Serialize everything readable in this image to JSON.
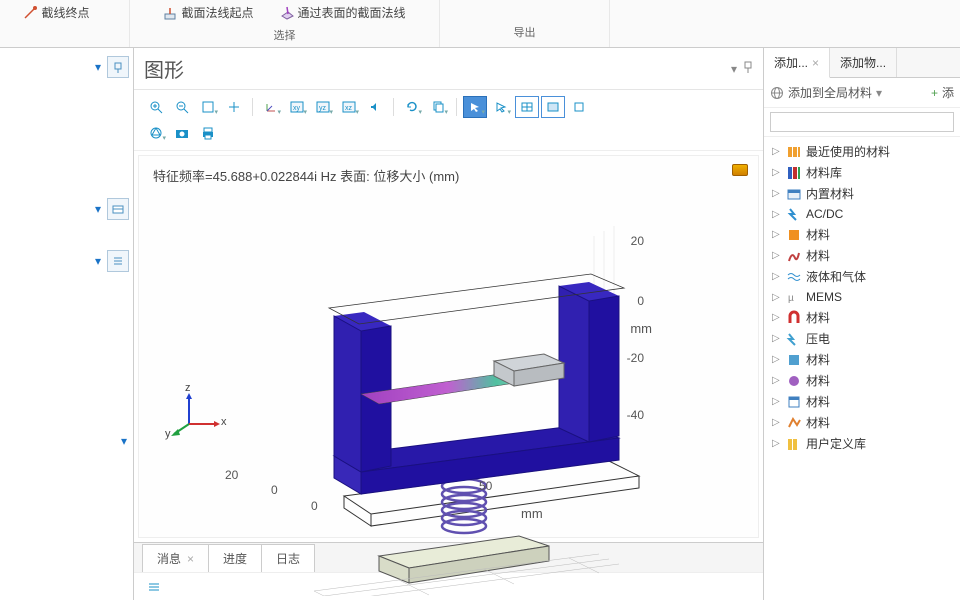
{
  "ribbon": {
    "items": [
      {
        "label": "截线终点"
      },
      {
        "label": "截面法线起点"
      },
      {
        "label": "通过表面的截面法线"
      }
    ],
    "group1": "选择",
    "group2": "导出"
  },
  "graphics": {
    "title": "图形",
    "plot_title": "特征频率=45.688+0.022844i Hz    表面: 位移大小 (mm)",
    "y_ticks": [
      "20",
      "0",
      "-20",
      "-40"
    ],
    "y_unit": "mm",
    "x_ticks_front": [
      "20",
      "0"
    ],
    "x_ticks_side": [
      "0",
      "50"
    ],
    "x_unit": "mm",
    "axes": {
      "x": "x",
      "y": "y",
      "z": "z"
    }
  },
  "bottom_tabs": {
    "items": [
      {
        "label": "消息",
        "closable": true
      },
      {
        "label": "进度",
        "closable": false
      },
      {
        "label": "日志",
        "closable": false
      }
    ]
  },
  "right": {
    "tabs": [
      {
        "label": "添加...",
        "closable": true
      },
      {
        "label": "添加物...",
        "closable": false
      }
    ],
    "sub_add": "添加到全局材料",
    "sub_add2": "添",
    "search_placeholder": "",
    "tree": [
      {
        "icon": "recent",
        "label": "最近使用的材料"
      },
      {
        "icon": "matlib",
        "label": "材料库"
      },
      {
        "icon": "builtin",
        "label": "内置材料"
      },
      {
        "icon": "acdc",
        "label": "AC/DC"
      },
      {
        "icon": "mat1",
        "label": "材料"
      },
      {
        "icon": "mat2",
        "label": "材料"
      },
      {
        "icon": "fluid",
        "label": "液体和气体"
      },
      {
        "icon": "mems",
        "label": "MEMS"
      },
      {
        "icon": "magnet",
        "label": "材料"
      },
      {
        "icon": "piezo",
        "label": "压电"
      },
      {
        "icon": "mat3",
        "label": "材料"
      },
      {
        "icon": "mat4",
        "label": "材料"
      },
      {
        "icon": "mat5",
        "label": "材料"
      },
      {
        "icon": "mat6",
        "label": "材料"
      },
      {
        "icon": "userlib",
        "label": "用户定义库"
      }
    ]
  },
  "chart_data": {
    "type": "3d-surface",
    "title": "特征频率=45.688+0.022844i Hz    表面: 位移大小 (mm)",
    "eigenfrequency_hz_real": 45.688,
    "eigenfrequency_hz_imag": 0.022844,
    "result_label": "位移大小 (mm)",
    "z_axis": {
      "ticks": [
        -40,
        -20,
        0,
        20
      ],
      "unit": "mm"
    },
    "x_axis_front": {
      "ticks": [
        0,
        20
      ],
      "unit": "mm"
    },
    "x_axis_side": {
      "ticks": [
        0,
        50
      ],
      "unit": "mm"
    },
    "note": "COMSOL eigenfrequency result — model shows U-shaped fixture on spring/base with beam, colored by displacement magnitude"
  }
}
